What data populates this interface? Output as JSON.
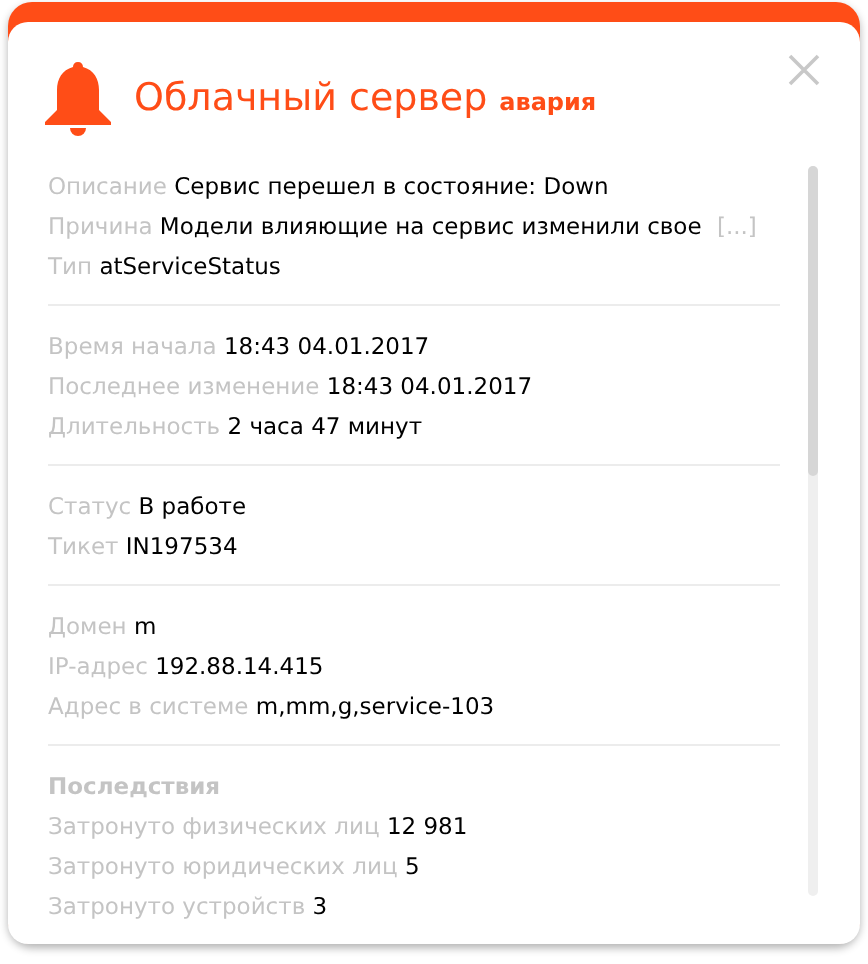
{
  "title": "Облачный сервер",
  "severity": "авария",
  "sections": [
    {
      "rows": [
        {
          "label": "Описание",
          "value": "Сервис перешел в состояние: Down"
        },
        {
          "label": "Причина",
          "value": "Модели влияющие на сервис изменили свое",
          "more": "[...]"
        },
        {
          "label": "Тип",
          "value": "atServiceStatus"
        }
      ]
    },
    {
      "rows": [
        {
          "label": "Время начала",
          "value": "18:43 04.01.2017"
        },
        {
          "label": "Последнее изменение",
          "value": "18:43 04.01.2017"
        },
        {
          "label": "Длительность",
          "value": "2 часа 47 минут"
        }
      ]
    },
    {
      "rows": [
        {
          "label": "Статус",
          "value": "В работе"
        },
        {
          "label": "Тикет",
          "value": "IN197534"
        }
      ]
    },
    {
      "rows": [
        {
          "label": "Домен",
          "value": "m"
        },
        {
          "label": "IP-адрес",
          "value": "192.88.14.415"
        },
        {
          "label": "Адрес в системе",
          "value": "m,mm,g,service-103"
        }
      ]
    },
    {
      "heading": "Последствия",
      "rows": [
        {
          "label": "Затронуто физических лиц",
          "value": "12 981"
        },
        {
          "label": "Затронуто юридических лиц",
          "value": "5"
        },
        {
          "label": "Затронуто устройств",
          "value": "3"
        }
      ]
    }
  ]
}
